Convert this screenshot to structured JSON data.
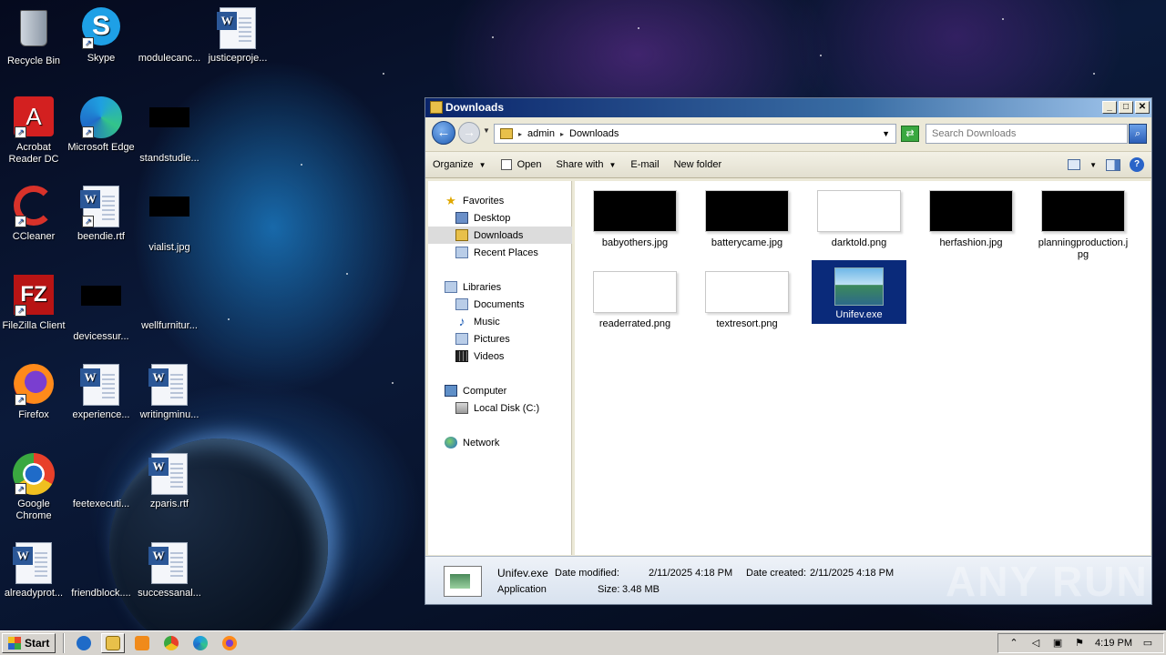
{
  "desktop": {
    "icons": [
      {
        "label": "Recycle Bin",
        "icon": "recycle-bin-icon"
      },
      {
        "label": "Skype",
        "icon": "skype-icon"
      },
      {
        "label": "modulecanc...",
        "icon": "blank-file-icon"
      },
      {
        "label": "justiceproje...",
        "icon": "word-document-icon"
      },
      {
        "label": "Acrobat Reader DC",
        "icon": "acrobat-icon"
      },
      {
        "label": "Microsoft Edge",
        "icon": "edge-icon"
      },
      {
        "label": "standstudie...",
        "icon": "image-file-icon"
      },
      {
        "label": "CCleaner",
        "icon": "ccleaner-icon"
      },
      {
        "label": "beendie.rtf",
        "icon": "word-document-icon"
      },
      {
        "label": "vialist.jpg",
        "icon": "image-file-icon"
      },
      {
        "label": "FileZilla Client",
        "icon": "filezilla-icon"
      },
      {
        "label": "devicessur...",
        "icon": "image-file-icon"
      },
      {
        "label": "wellfurnitur...",
        "icon": "blank-file-icon"
      },
      {
        "label": "Firefox",
        "icon": "firefox-icon"
      },
      {
        "label": "experience...",
        "icon": "word-document-icon"
      },
      {
        "label": "writingminu...",
        "icon": "word-document-icon"
      },
      {
        "label": "Google Chrome",
        "icon": "chrome-icon"
      },
      {
        "label": "feetexecuti...",
        "icon": "blank-file-icon"
      },
      {
        "label": "zparis.rtf",
        "icon": "word-document-icon"
      },
      {
        "label": "alreadyprot...",
        "icon": "word-document-icon"
      },
      {
        "label": "friendblock....",
        "icon": "blank-file-icon"
      },
      {
        "label": "successanal...",
        "icon": "word-document-icon"
      }
    ]
  },
  "window": {
    "title": "Downloads",
    "buttons": {
      "minimize": "_",
      "maximize": "□",
      "close": "✕"
    },
    "address": {
      "segments": [
        "admin",
        "Downloads"
      ]
    },
    "search": {
      "placeholder": "Search Downloads"
    },
    "toolbar": {
      "organize": "Organize",
      "open": "Open",
      "share_with": "Share with",
      "email": "E-mail",
      "new_folder": "New folder"
    },
    "nav": {
      "favorites": "Favorites",
      "desktop": "Desktop",
      "downloads": "Downloads",
      "recent_places": "Recent Places",
      "libraries": "Libraries",
      "documents": "Documents",
      "music": "Music",
      "pictures": "Pictures",
      "videos": "Videos",
      "computer": "Computer",
      "local_disk": "Local Disk (C:)",
      "network": "Network"
    },
    "files": [
      {
        "name": "babyothers.jpg",
        "thumb": "black"
      },
      {
        "name": "batterycame.jpg",
        "thumb": "black"
      },
      {
        "name": "darktold.png",
        "thumb": "white"
      },
      {
        "name": "herfashion.jpg",
        "thumb": "black"
      },
      {
        "name": "planningproduction.jpg",
        "thumb": "black"
      },
      {
        "name": "readerrated.png",
        "thumb": "white"
      },
      {
        "name": "textresort.png",
        "thumb": "white"
      },
      {
        "name": "Unifev.exe",
        "thumb": "exe",
        "selected": true
      }
    ],
    "details": {
      "name": "Unifev.exe",
      "type": "Application",
      "modified_label": "Date modified:",
      "modified_value": "2/11/2025 4:18 PM",
      "created_label": "Date created:",
      "created_value": "2/11/2025 4:18 PM",
      "size_label": "Size:",
      "size_value": "3.48 MB"
    }
  },
  "watermark": "ANY RUN",
  "taskbar": {
    "start": "Start",
    "clock": "4:19 PM"
  }
}
